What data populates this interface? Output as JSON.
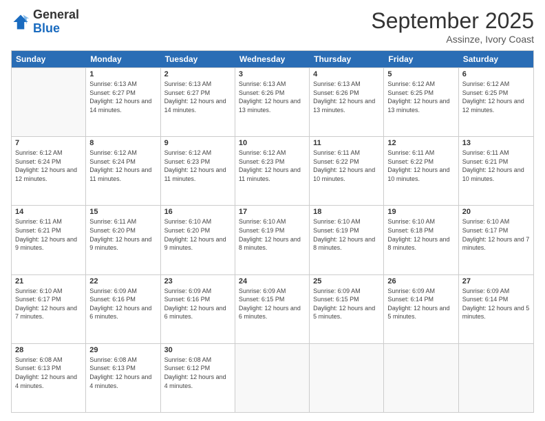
{
  "logo": {
    "general": "General",
    "blue": "Blue"
  },
  "header": {
    "month": "September 2025",
    "location": "Assinze, Ivory Coast"
  },
  "days": [
    "Sunday",
    "Monday",
    "Tuesday",
    "Wednesday",
    "Thursday",
    "Friday",
    "Saturday"
  ],
  "weeks": [
    [
      {
        "day": "",
        "empty": true
      },
      {
        "day": "1",
        "sunrise": "Sunrise: 6:13 AM",
        "sunset": "Sunset: 6:27 PM",
        "daylight": "Daylight: 12 hours and 14 minutes."
      },
      {
        "day": "2",
        "sunrise": "Sunrise: 6:13 AM",
        "sunset": "Sunset: 6:27 PM",
        "daylight": "Daylight: 12 hours and 14 minutes."
      },
      {
        "day": "3",
        "sunrise": "Sunrise: 6:13 AM",
        "sunset": "Sunset: 6:26 PM",
        "daylight": "Daylight: 12 hours and 13 minutes."
      },
      {
        "day": "4",
        "sunrise": "Sunrise: 6:13 AM",
        "sunset": "Sunset: 6:26 PM",
        "daylight": "Daylight: 12 hours and 13 minutes."
      },
      {
        "day": "5",
        "sunrise": "Sunrise: 6:12 AM",
        "sunset": "Sunset: 6:25 PM",
        "daylight": "Daylight: 12 hours and 13 minutes."
      },
      {
        "day": "6",
        "sunrise": "Sunrise: 6:12 AM",
        "sunset": "Sunset: 6:25 PM",
        "daylight": "Daylight: 12 hours and 12 minutes."
      }
    ],
    [
      {
        "day": "7",
        "sunrise": "Sunrise: 6:12 AM",
        "sunset": "Sunset: 6:24 PM",
        "daylight": "Daylight: 12 hours and 12 minutes."
      },
      {
        "day": "8",
        "sunrise": "Sunrise: 6:12 AM",
        "sunset": "Sunset: 6:24 PM",
        "daylight": "Daylight: 12 hours and 11 minutes."
      },
      {
        "day": "9",
        "sunrise": "Sunrise: 6:12 AM",
        "sunset": "Sunset: 6:23 PM",
        "daylight": "Daylight: 12 hours and 11 minutes."
      },
      {
        "day": "10",
        "sunrise": "Sunrise: 6:12 AM",
        "sunset": "Sunset: 6:23 PM",
        "daylight": "Daylight: 12 hours and 11 minutes."
      },
      {
        "day": "11",
        "sunrise": "Sunrise: 6:11 AM",
        "sunset": "Sunset: 6:22 PM",
        "daylight": "Daylight: 12 hours and 10 minutes."
      },
      {
        "day": "12",
        "sunrise": "Sunrise: 6:11 AM",
        "sunset": "Sunset: 6:22 PM",
        "daylight": "Daylight: 12 hours and 10 minutes."
      },
      {
        "day": "13",
        "sunrise": "Sunrise: 6:11 AM",
        "sunset": "Sunset: 6:21 PM",
        "daylight": "Daylight: 12 hours and 10 minutes."
      }
    ],
    [
      {
        "day": "14",
        "sunrise": "Sunrise: 6:11 AM",
        "sunset": "Sunset: 6:21 PM",
        "daylight": "Daylight: 12 hours and 9 minutes."
      },
      {
        "day": "15",
        "sunrise": "Sunrise: 6:11 AM",
        "sunset": "Sunset: 6:20 PM",
        "daylight": "Daylight: 12 hours and 9 minutes."
      },
      {
        "day": "16",
        "sunrise": "Sunrise: 6:10 AM",
        "sunset": "Sunset: 6:20 PM",
        "daylight": "Daylight: 12 hours and 9 minutes."
      },
      {
        "day": "17",
        "sunrise": "Sunrise: 6:10 AM",
        "sunset": "Sunset: 6:19 PM",
        "daylight": "Daylight: 12 hours and 8 minutes."
      },
      {
        "day": "18",
        "sunrise": "Sunrise: 6:10 AM",
        "sunset": "Sunset: 6:19 PM",
        "daylight": "Daylight: 12 hours and 8 minutes."
      },
      {
        "day": "19",
        "sunrise": "Sunrise: 6:10 AM",
        "sunset": "Sunset: 6:18 PM",
        "daylight": "Daylight: 12 hours and 8 minutes."
      },
      {
        "day": "20",
        "sunrise": "Sunrise: 6:10 AM",
        "sunset": "Sunset: 6:17 PM",
        "daylight": "Daylight: 12 hours and 7 minutes."
      }
    ],
    [
      {
        "day": "21",
        "sunrise": "Sunrise: 6:10 AM",
        "sunset": "Sunset: 6:17 PM",
        "daylight": "Daylight: 12 hours and 7 minutes."
      },
      {
        "day": "22",
        "sunrise": "Sunrise: 6:09 AM",
        "sunset": "Sunset: 6:16 PM",
        "daylight": "Daylight: 12 hours and 6 minutes."
      },
      {
        "day": "23",
        "sunrise": "Sunrise: 6:09 AM",
        "sunset": "Sunset: 6:16 PM",
        "daylight": "Daylight: 12 hours and 6 minutes."
      },
      {
        "day": "24",
        "sunrise": "Sunrise: 6:09 AM",
        "sunset": "Sunset: 6:15 PM",
        "daylight": "Daylight: 12 hours and 6 minutes."
      },
      {
        "day": "25",
        "sunrise": "Sunrise: 6:09 AM",
        "sunset": "Sunset: 6:15 PM",
        "daylight": "Daylight: 12 hours and 5 minutes."
      },
      {
        "day": "26",
        "sunrise": "Sunrise: 6:09 AM",
        "sunset": "Sunset: 6:14 PM",
        "daylight": "Daylight: 12 hours and 5 minutes."
      },
      {
        "day": "27",
        "sunrise": "Sunrise: 6:09 AM",
        "sunset": "Sunset: 6:14 PM",
        "daylight": "Daylight: 12 hours and 5 minutes."
      }
    ],
    [
      {
        "day": "28",
        "sunrise": "Sunrise: 6:08 AM",
        "sunset": "Sunset: 6:13 PM",
        "daylight": "Daylight: 12 hours and 4 minutes."
      },
      {
        "day": "29",
        "sunrise": "Sunrise: 6:08 AM",
        "sunset": "Sunset: 6:13 PM",
        "daylight": "Daylight: 12 hours and 4 minutes."
      },
      {
        "day": "30",
        "sunrise": "Sunrise: 6:08 AM",
        "sunset": "Sunset: 6:12 PM",
        "daylight": "Daylight: 12 hours and 4 minutes."
      },
      {
        "day": "",
        "empty": true
      },
      {
        "day": "",
        "empty": true
      },
      {
        "day": "",
        "empty": true
      },
      {
        "day": "",
        "empty": true
      }
    ]
  ]
}
